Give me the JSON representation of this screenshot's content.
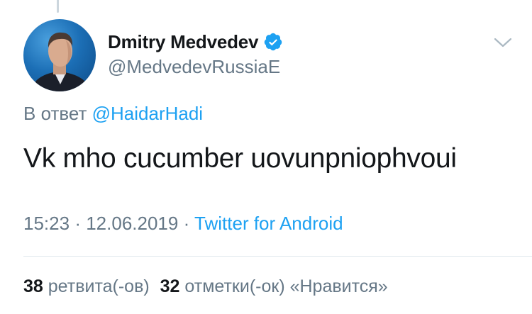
{
  "tweet": {
    "author": {
      "name": "Dmitry Medvedev",
      "handle": "@MedvedevRussiaE",
      "verified": true
    },
    "reply": {
      "prefix": "В ответ",
      "mention": "@HaidarHadi"
    },
    "text": "Vk mho cucumber uovunpniophvoui",
    "meta": {
      "time": "15:23",
      "separator": "·",
      "date": "12.06.2019",
      "source": "Twitter for Android"
    },
    "stats": {
      "retweets_count": "38",
      "retweets_label": "ретвита(-ов)",
      "likes_count": "32",
      "likes_label": "отметки(-ок) «Нравится»"
    }
  },
  "icons": {
    "verified": "verified-badge-icon",
    "more": "chevron-down-icon"
  },
  "colors": {
    "link": "#1da1f2",
    "secondary_text": "#657786",
    "primary_text": "#14171a",
    "divider": "#e1e8ed"
  }
}
